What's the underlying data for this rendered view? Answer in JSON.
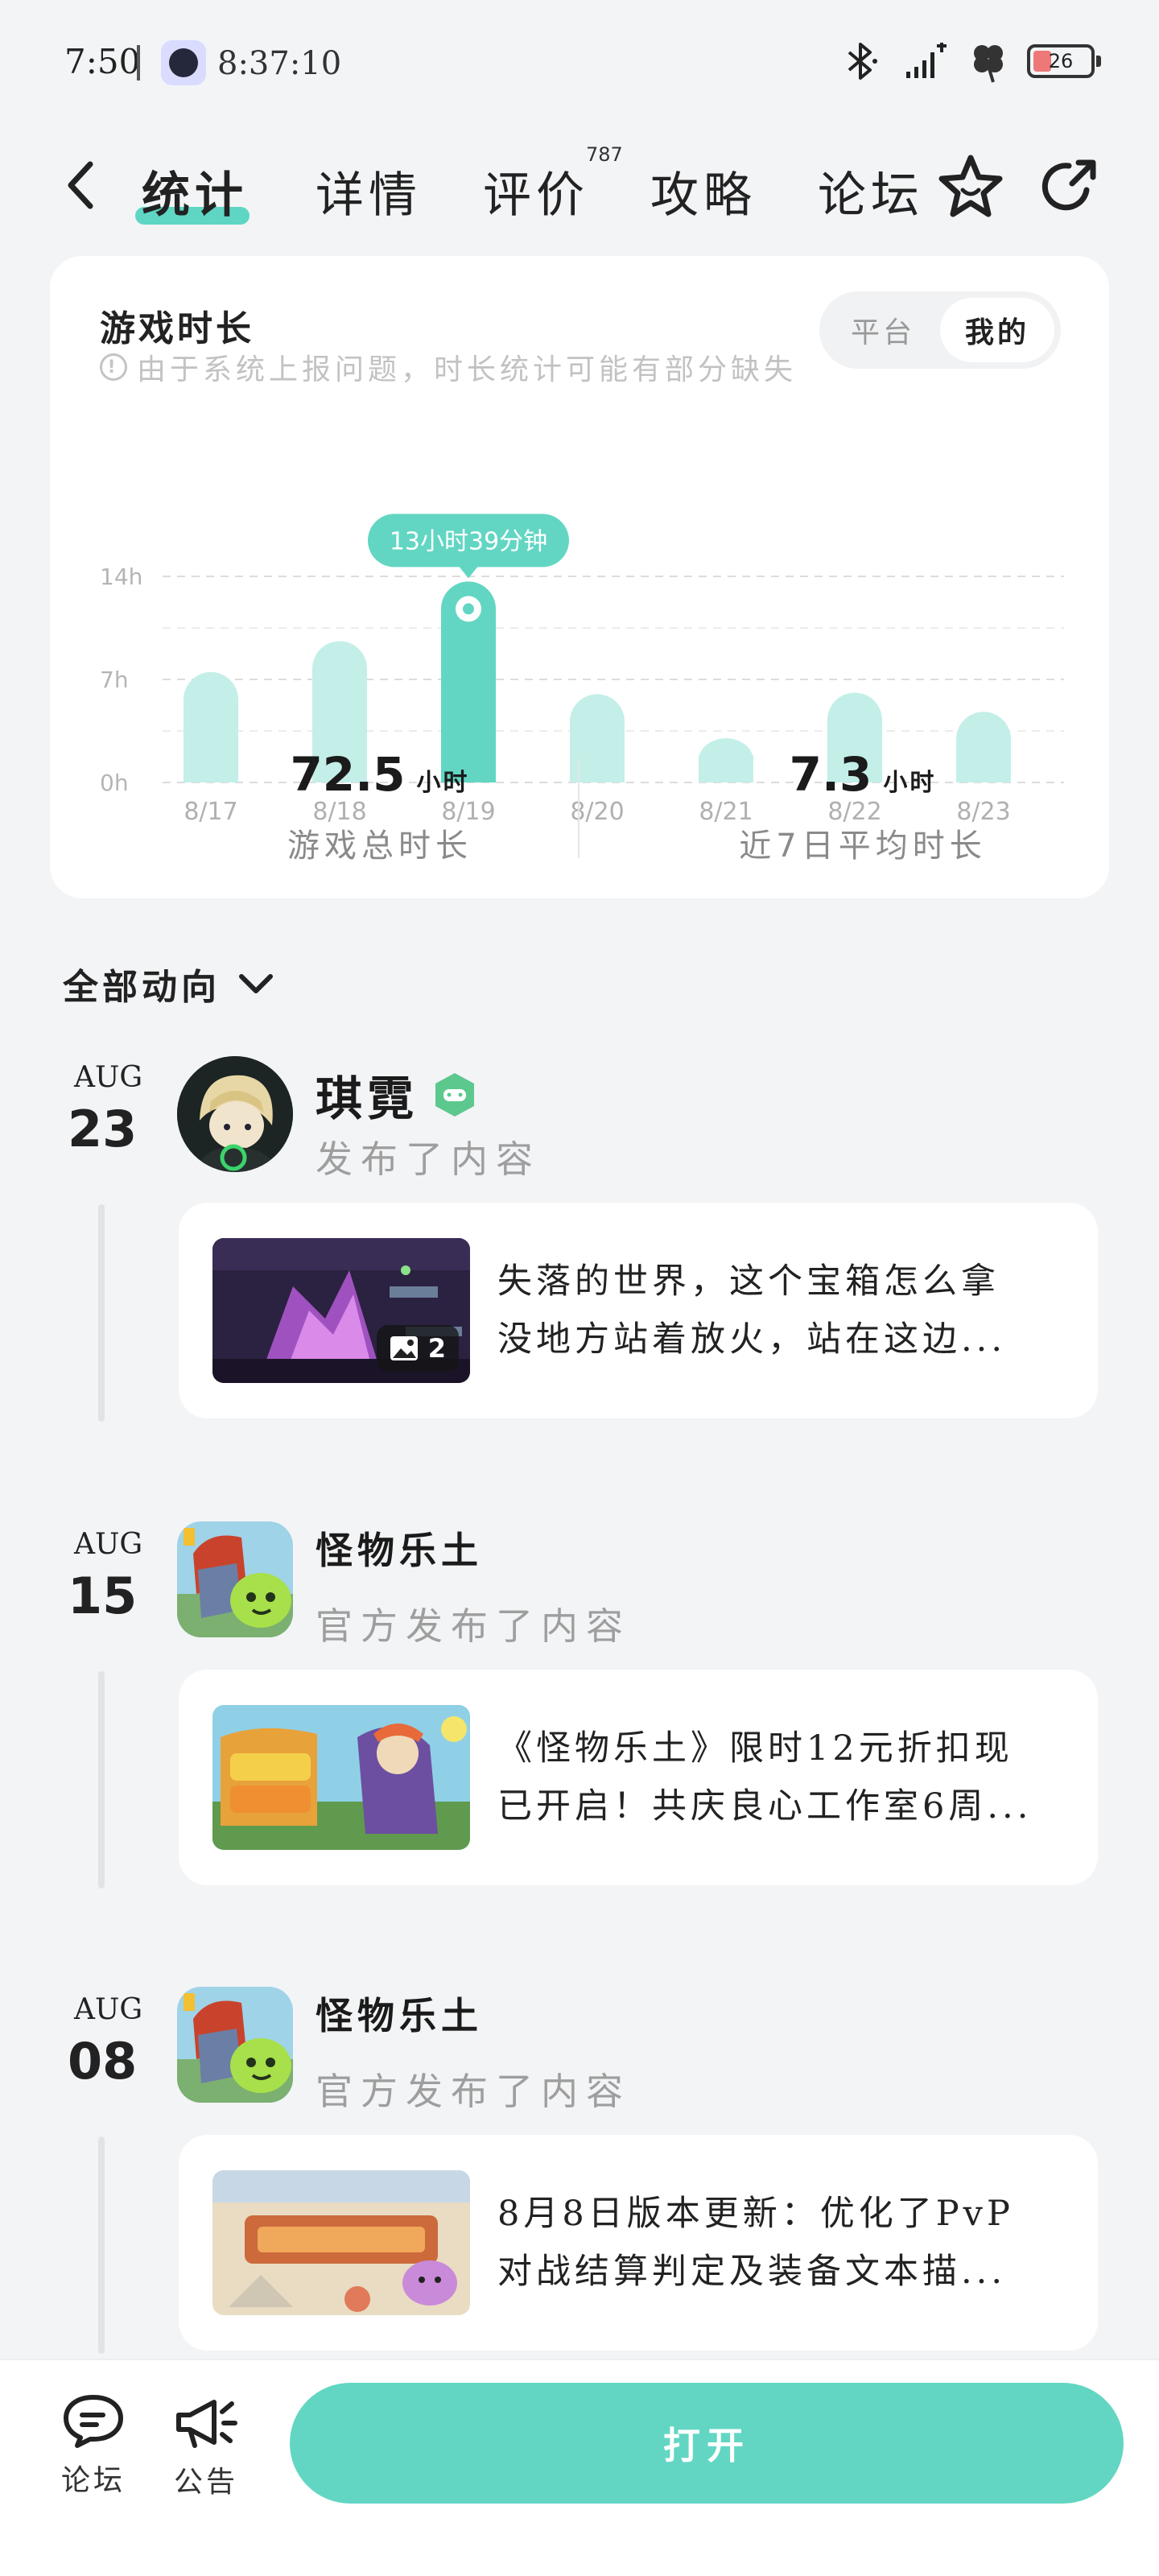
{
  "status_bar": {
    "time": "7:50",
    "clock": "8:37:10",
    "battery": "26",
    "icons": [
      "bluetooth-icon",
      "signal-icon",
      "clover-icon",
      "battery-icon"
    ]
  },
  "nav": {
    "tabs": [
      {
        "label": "统计",
        "active": true
      },
      {
        "label": "详情",
        "active": false
      },
      {
        "label": "评价",
        "active": false,
        "badge": "787"
      },
      {
        "label": "攻略",
        "active": false
      },
      {
        "label": "论坛",
        "active": false
      }
    ],
    "icons": [
      "back-arrow-icon",
      "star-face-icon",
      "share-icon"
    ]
  },
  "playtime": {
    "title": "游戏时长",
    "note": "由于系统上报问题，时长统计可能有部分缺失",
    "segment": {
      "options": [
        "平台",
        "我的"
      ],
      "selected": "我的"
    },
    "total_value": "72.5",
    "total_unit": "小时",
    "total_label": "游戏总时长",
    "avg_value": "7.3",
    "avg_unit": "小时",
    "avg_label": "近7日平均时长"
  },
  "chart_data": {
    "type": "bar",
    "categories": [
      "8/17",
      "8/18",
      "8/19",
      "8/20",
      "8/21",
      "8/22",
      "8/23"
    ],
    "values": [
      7.5,
      9.6,
      13.65,
      6.0,
      3.0,
      6.1,
      4.8
    ],
    "unit": "h",
    "ylim": [
      0,
      14
    ],
    "yticks": [
      "0h",
      "7h",
      "14h"
    ],
    "highlight_index": 2,
    "tooltip": "13小时39分钟",
    "grid": true,
    "colors": {
      "bar": "#c3efe8",
      "highlight": "#62d6c3"
    }
  },
  "feed": {
    "filter_label": "全部动向",
    "entries": [
      {
        "month": "AUG",
        "day": "23",
        "author": "琪霓",
        "action": "发布了内容",
        "post_lines": [
          "失落的世界，这个宝箱怎么拿",
          "没地方站着放火，站在这边..."
        ],
        "image_count": "2"
      },
      {
        "month": "AUG",
        "day": "15",
        "author": "怪物乐土",
        "action": "官方发布了内容",
        "post_lines": [
          "《怪物乐土》限时12元折扣现",
          "已开启！共庆良心工作室6周..."
        ]
      },
      {
        "month": "AUG",
        "day": "08",
        "author": "怪物乐土",
        "action": "官方发布了内容",
        "post_lines": [
          "8月8日版本更新：优化了PvP",
          "对战结算判定及装备文本描..."
        ]
      }
    ]
  },
  "bottom": {
    "forum_label": "论坛",
    "notice_label": "公告",
    "open_label": "打开"
  },
  "colors": {
    "accent": "#62d6c3",
    "accent_light": "#c3efe8",
    "background": "#f3f4f6"
  }
}
